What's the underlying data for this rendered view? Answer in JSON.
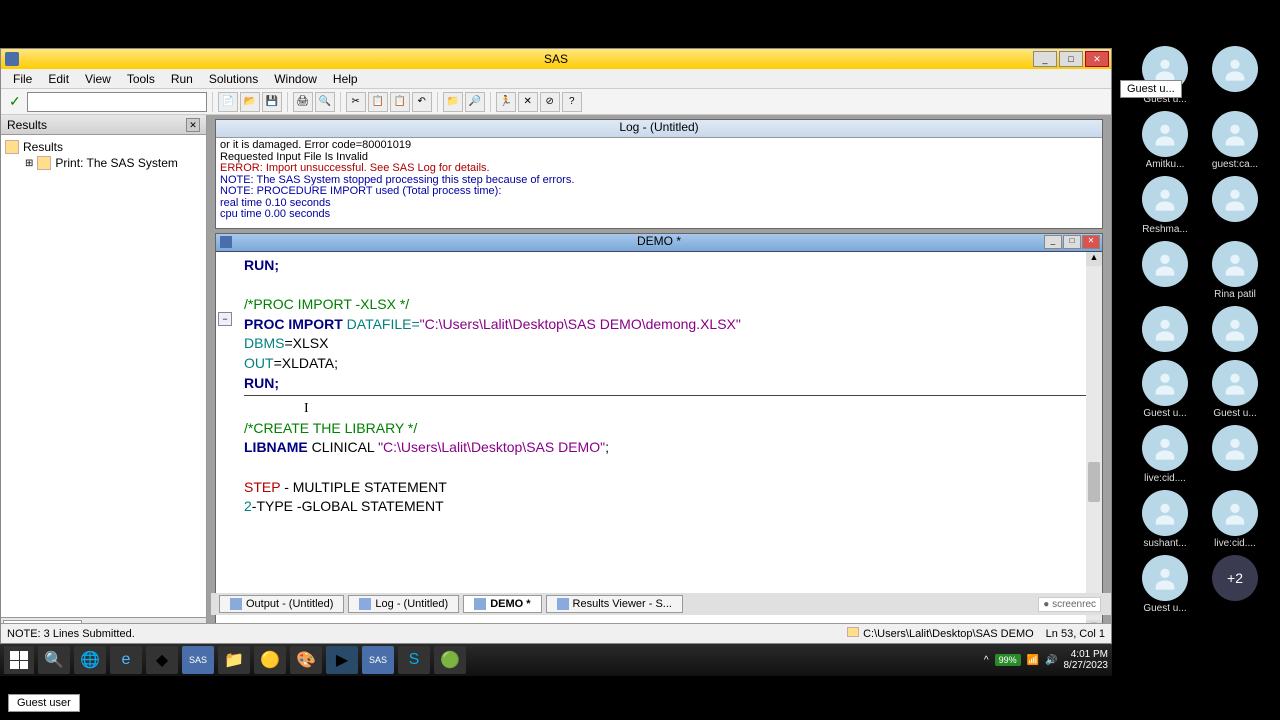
{
  "app": {
    "title": "SAS"
  },
  "menu": [
    "File",
    "Edit",
    "View",
    "Tools",
    "Run",
    "Solutions",
    "Window",
    "Help"
  ],
  "results_panel": {
    "title": "Results",
    "root": "Results",
    "child": "Print: The SAS System",
    "tab": "Results"
  },
  "log_window": {
    "title": "Log - (Untitled)",
    "lines": [
      {
        "cls": "",
        "text": "or it is damaged.   Error code=80001019"
      },
      {
        "cls": "",
        "text": "Requested Input File Is Invalid"
      },
      {
        "cls": "err",
        "text": "ERROR: Import unsuccessful.  See SAS Log for details."
      },
      {
        "cls": "note",
        "text": "NOTE: The SAS System stopped processing this step because of errors."
      },
      {
        "cls": "note",
        "text": "NOTE: PROCEDURE IMPORT used (Total process time):"
      },
      {
        "cls": "note",
        "text": "      real time           0.10 seconds"
      },
      {
        "cls": "note",
        "text": "      cpu time            0.00 seconds"
      }
    ]
  },
  "editor": {
    "title": "DEMO *",
    "code": {
      "l1": "RUN;",
      "l2": "/*PROC IMPORT -XLSX */",
      "l3_kw": "PROC IMPORT",
      "l3_op": " DATAFILE=",
      "l3_str": "\"C:\\Users\\Lalit\\Desktop\\SAS DEMO\\demong.XLSX\"",
      "l4_op": "DBMS",
      "l4_rest": "=XLSX",
      "l5_op": "OUT",
      "l5_rest": "=XLDATA;",
      "l6": "RUN;",
      "l7": "/*CREATE THE LIBRARY */",
      "l8_kw": "LIBNAME",
      "l8_rest": " CLINICAL ",
      "l8_str": "\"C:\\Users\\Lalit\\Desktop\\SAS DEMO\"",
      "l9_step": "STEP",
      "l9_rest": " - MULTIPLE STATEMENT",
      "l10_num": "2",
      "l10_rest": "-TYPE -GLOBAL STATEMENT"
    }
  },
  "bottom_tabs": [
    {
      "label": "Output - (Untitled)",
      "active": false
    },
    {
      "label": "Log - (Untitled)",
      "active": false
    },
    {
      "label": "DEMO *",
      "active": true
    },
    {
      "label": "Results Viewer - S...",
      "active": false
    }
  ],
  "screenrec": "screenrec",
  "statusbar": {
    "left": "NOTE: 3 Lines Submitted.",
    "path": "C:\\Users\\Lalit\\Desktop\\SAS DEMO",
    "pos": "Ln 53, Col 1"
  },
  "taskbar": {
    "battery": "99%",
    "time": "4:01 PM",
    "date": "8/27/2023"
  },
  "participants": [
    "Guest u...",
    "",
    "Amitku...",
    "guest:ca...",
    "Reshma...",
    "",
    "",
    "Rina patil",
    "",
    "",
    "Guest u...",
    "Guest u...",
    "live:cid....",
    "",
    "sushant...",
    "live:cid....",
    "Guest u..."
  ],
  "more_count": "+2",
  "hover_tooltip": "Guest u...",
  "guest_badge": "Guest user"
}
